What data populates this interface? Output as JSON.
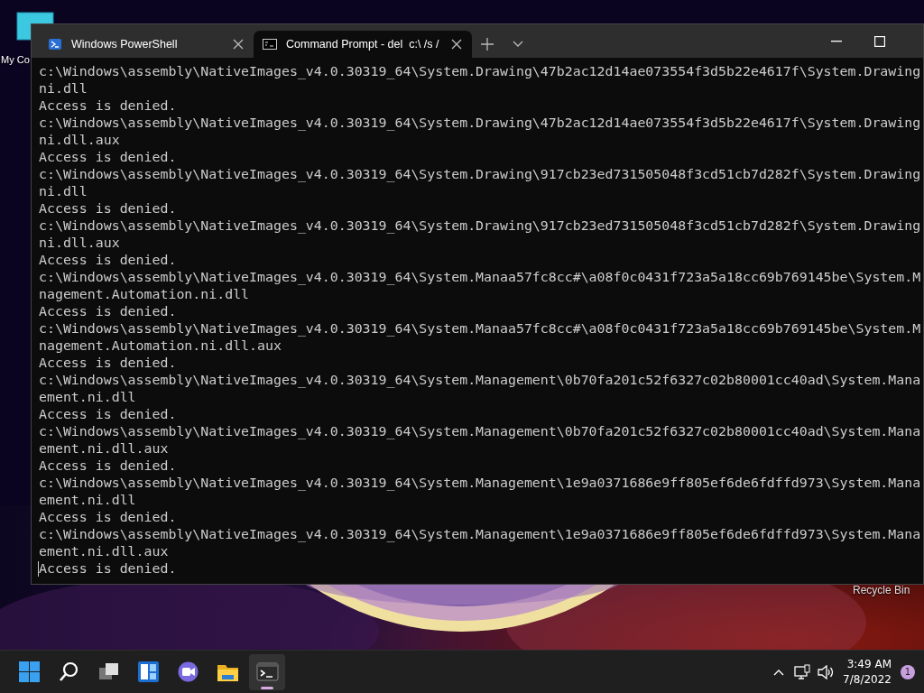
{
  "desktop": {
    "icons": [
      {
        "kind": "computer",
        "label": "My Co"
      },
      {
        "kind": "recycle",
        "label": "Recycle Bin"
      }
    ]
  },
  "window": {
    "tabs": [
      {
        "kind": "powershell",
        "label": "Windows PowerShell",
        "selected": false
      },
      {
        "kind": "cmd",
        "label": "Command Prompt - del  c:\\ /s /",
        "selected": true
      }
    ],
    "console": {
      "lines": [
        "c:\\Windows\\assembly\\NativeImages_v4.0.30319_64\\System.Drawing\\47b2ac12d14ae073554f3d5b22e4617f\\System.Drawing",
        "ni.dll",
        "Access is denied.",
        "c:\\Windows\\assembly\\NativeImages_v4.0.30319_64\\System.Drawing\\47b2ac12d14ae073554f3d5b22e4617f\\System.Drawing",
        "ni.dll.aux",
        "Access is denied.",
        "c:\\Windows\\assembly\\NativeImages_v4.0.30319_64\\System.Drawing\\917cb23ed731505048f3cd51cb7d282f\\System.Drawing",
        "ni.dll",
        "Access is denied.",
        "c:\\Windows\\assembly\\NativeImages_v4.0.30319_64\\System.Drawing\\917cb23ed731505048f3cd51cb7d282f\\System.Drawing",
        "ni.dll.aux",
        "Access is denied.",
        "c:\\Windows\\assembly\\NativeImages_v4.0.30319_64\\System.Manaa57fc8cc#\\a08f0c0431f723a5a18cc69b769145be\\System.M",
        "nagement.Automation.ni.dll",
        "Access is denied.",
        "c:\\Windows\\assembly\\NativeImages_v4.0.30319_64\\System.Manaa57fc8cc#\\a08f0c0431f723a5a18cc69b769145be\\System.M",
        "nagement.Automation.ni.dll.aux",
        "Access is denied.",
        "c:\\Windows\\assembly\\NativeImages_v4.0.30319_64\\System.Management\\0b70fa201c52f6327c02b80001cc40ad\\System.Mana",
        "ement.ni.dll",
        "Access is denied.",
        "c:\\Windows\\assembly\\NativeImages_v4.0.30319_64\\System.Management\\0b70fa201c52f6327c02b80001cc40ad\\System.Mana",
        "ement.ni.dll.aux",
        "Access is denied.",
        "c:\\Windows\\assembly\\NativeImages_v4.0.30319_64\\System.Management\\1e9a0371686e9ff805ef6de6fdffd973\\System.Mana",
        "ement.ni.dll",
        "Access is denied.",
        "c:\\Windows\\assembly\\NativeImages_v4.0.30319_64\\System.Management\\1e9a0371686e9ff805ef6de6fdffd973\\System.Mana",
        "ement.ni.dll.aux",
        "Access is denied."
      ]
    }
  },
  "taskbar": {
    "apps": [
      {
        "kind": "start",
        "selected": false
      },
      {
        "kind": "search",
        "selected": false
      },
      {
        "kind": "taskview",
        "selected": false
      },
      {
        "kind": "widgets",
        "selected": false
      },
      {
        "kind": "chat",
        "selected": false
      },
      {
        "kind": "explorer",
        "selected": false
      },
      {
        "kind": "terminal",
        "selected": true
      }
    ],
    "tray": {
      "time": "3:49 AM",
      "date": "7/8/2022",
      "notifications": "1"
    }
  }
}
